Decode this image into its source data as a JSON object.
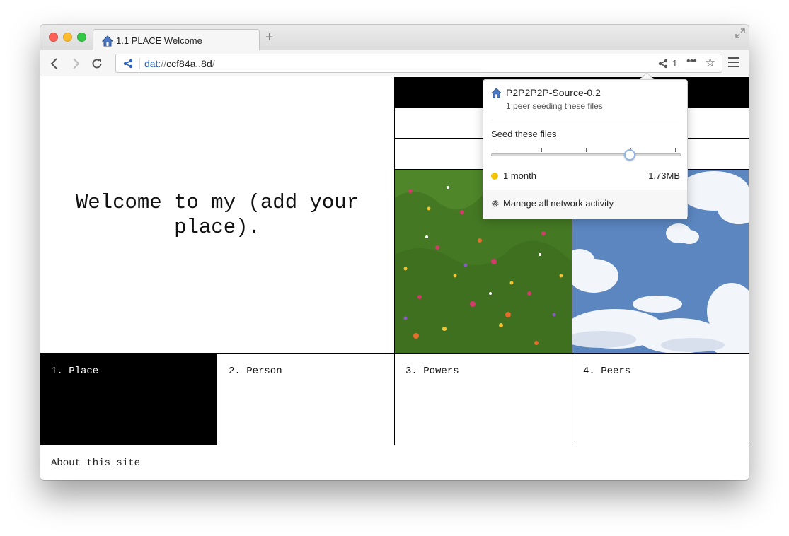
{
  "browser": {
    "tab": {
      "title": "1.1 PLACE Welcome"
    },
    "new_tab_label": "+",
    "address": {
      "scheme": "dat:",
      "slashes": "//",
      "host": "ccf84a..8d",
      "trailing": "/"
    },
    "peer_count": "1",
    "more_label": "•••",
    "star_label": "☆"
  },
  "popover": {
    "site_name": "P2P2P2P-Source-0.2",
    "peer_status": "1 peer seeding these files",
    "seed_label": "Seed these files",
    "seed_duration": "1 month",
    "seed_size": "1.73MB",
    "slider_level": 0.73,
    "slider_ticks": 5,
    "manage_label": "Manage all network activity",
    "status_color": "#f5c400"
  },
  "page": {
    "heading": "Welcome to my (add your place).",
    "nav": [
      {
        "label": "1. Place",
        "active": true
      },
      {
        "label": "2. Person",
        "active": false
      },
      {
        "label": "3. Powers",
        "active": false
      },
      {
        "label": "4. Peers",
        "active": false
      }
    ],
    "about": "About this site"
  },
  "icons": {
    "tab": "home-icon",
    "back": "back-arrow-icon",
    "forward": "forward-arrow-icon",
    "reload": "reload-icon",
    "share": "share-icon",
    "menu": "hamburger-menu-icon",
    "settings": "gear-icon"
  }
}
